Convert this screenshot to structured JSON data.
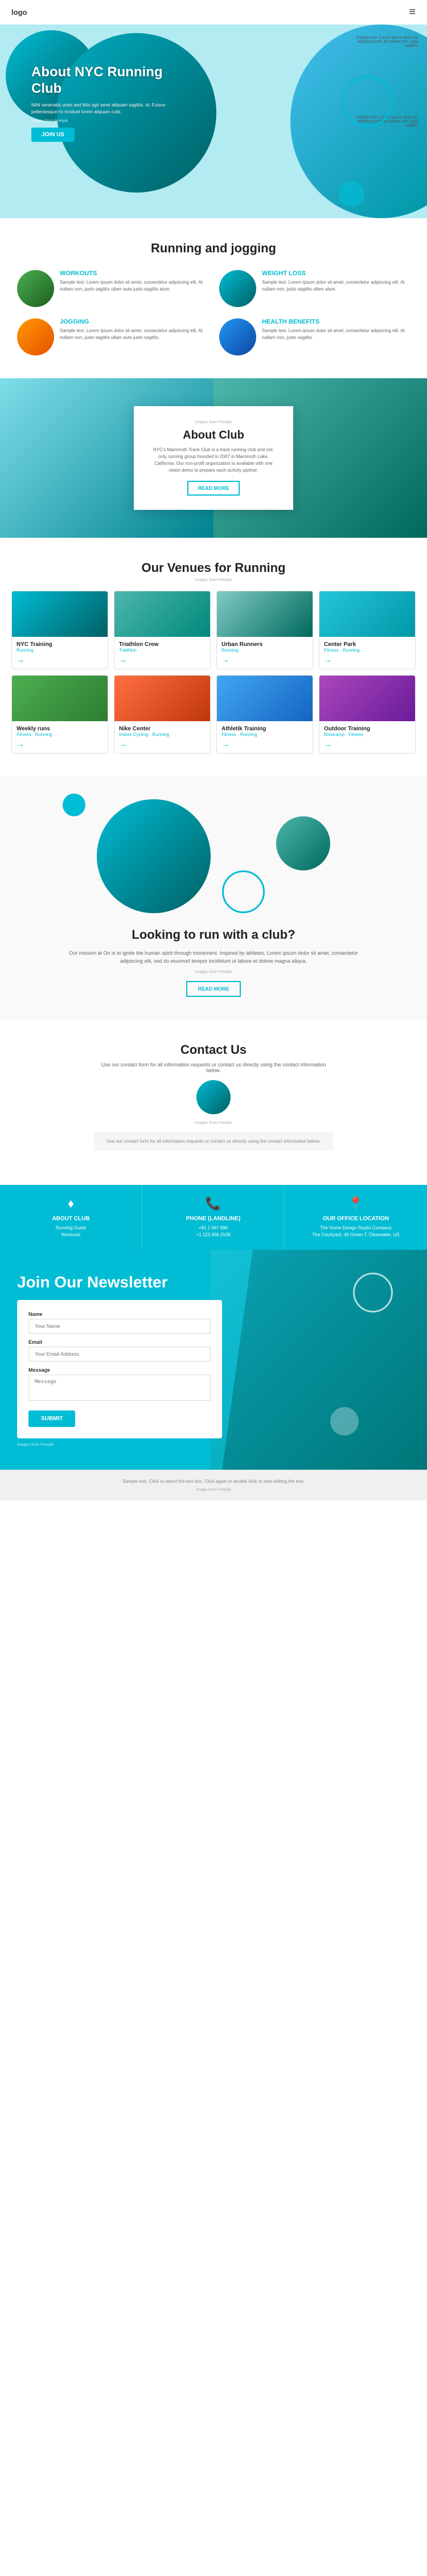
{
  "nav": {
    "logo": "logo",
    "menu_icon": "≡"
  },
  "hero": {
    "title": "About NYC Running Club",
    "description": "Nihil venenatis urats sed felis agit amet aliquam sagittis. Id. Fuisce pellentesque mi incidunt lorem aliquam culis.",
    "img_source": "Images from Freepik",
    "join_label": "JOIN US",
    "text_right1": "Sample text. Lorem ipsum dolor sit, adipiscing elit. At nullam non, justo sagittis.",
    "text_right2": "Sample text. Lorem ipsum dolor sit, adipiscing elit. At nullam non, justo sagittis."
  },
  "running": {
    "section_title": "Running and jogging",
    "items": [
      {
        "id": "workouts",
        "title": "WORKOUTS",
        "text": "Sample text. Lorem ipsum dolor sit amet, consectetur adipiscing elit. At nullam non, justo sagittis ullam aute justo sagittis alum.",
        "color": "teal"
      },
      {
        "id": "weight-loss",
        "title": "WEIGHT LOSS",
        "text": "Sample text. Lorem ipsum dolor sit amet, consectetur adipiscing elit. At nullam non, justo sagittis ullam alum.",
        "color": "green"
      },
      {
        "id": "jogging",
        "title": "JOGGING",
        "text": "Sample text. Lorem ipsum dolor sit amet, consectetur adipiscing elit. At nullam non, justo sagittis ullam aute justo sagittis.",
        "color": "orange"
      },
      {
        "id": "health-benefits",
        "title": "HEALTH BENEFITS",
        "text": "Sample text. Lorem ipsum dolor sit amet, consectetur adipiscing elit. At nullam non, justo sagittis.",
        "color": "blue"
      }
    ]
  },
  "about_club": {
    "img_source": "Images from Freepik",
    "title": "About Club",
    "description": "NYC's Mammoth Track Club is a track running club and not-only running group founded in 2007 in Mammoth Lake, California. Our non-profit organization is available with one vision demo to prepare each activity partner.",
    "read_more_label": "READ MORE"
  },
  "venues": {
    "section_title": "Our Venues for Running",
    "img_source": "Images from Freepik",
    "items": [
      {
        "name": "NYC Training",
        "type": "Running",
        "color": "v1"
      },
      {
        "name": "Triathlon Crew",
        "type": "Triathlon",
        "color": "v2"
      },
      {
        "name": "Urban Runners",
        "type": "Running",
        "color": "v3"
      },
      {
        "name": "Center Park",
        "type": "Fitness · Running",
        "color": "v4"
      },
      {
        "name": "Weekly runs",
        "type": "Fitness · Running",
        "color": "v5"
      },
      {
        "name": "Nike Center",
        "type": "Indoor Cycling · Running",
        "color": "v6"
      },
      {
        "name": "Athletik Training",
        "type": "Fitness · Running",
        "color": "v7"
      },
      {
        "name": "Outdoor Training",
        "type": "Bootcamp · Fitness",
        "color": "v8"
      }
    ],
    "arrow": "→"
  },
  "looking": {
    "title": "Looking to run with a club?",
    "description": "Our mission at On is to ignite the human spirit through movement. Inspired by athletes, Lorem ipsum dolor sit amet, consectetur adipiscing elit, sed do eiusmod tempor incididunt ut labore et dolore magna aliqua.",
    "img_source": "Images from Freepik",
    "read_more_label": "READ MORE"
  },
  "contact": {
    "title": "Contact Us",
    "description": "Use our contact form for all information requests or contact us directly using the contact information below.",
    "img_source": "Images from Freepik",
    "form_note": "Use our contact form for all information requests or contact us directly using the contact information below.",
    "cards": [
      {
        "id": "about-club",
        "icon": "♦",
        "title": "ABOUT CLUB",
        "lines": [
          "Running Guide",
          "Workouts"
        ]
      },
      {
        "id": "phone",
        "icon": "📞",
        "title": "PHONE (LANDLINE)",
        "lines": [
          "+91 1 567 890",
          "+1 123 456 2106"
        ]
      },
      {
        "id": "office",
        "icon": "📍",
        "title": "OUR OFFICE LOCATION",
        "lines": [
          "The Home Design Studio Company",
          "The Courtyard, 45 Green T. Clearwater, US"
        ]
      }
    ]
  },
  "newsletter": {
    "title": "Join Our Newsletter",
    "form": {
      "name_label": "Name",
      "name_placeholder": "Your Name",
      "email_label": "Email",
      "email_placeholder": "Your Email Address",
      "message_label": "Message",
      "message_placeholder": "Message",
      "submit_label": "SUBMIT"
    },
    "img_source": "Images from Freepik"
  },
  "footer": {
    "text": "Sample text. Click to select the text box. Click again or double click to start editing the text.",
    "img_source": "Image from Freepik"
  }
}
